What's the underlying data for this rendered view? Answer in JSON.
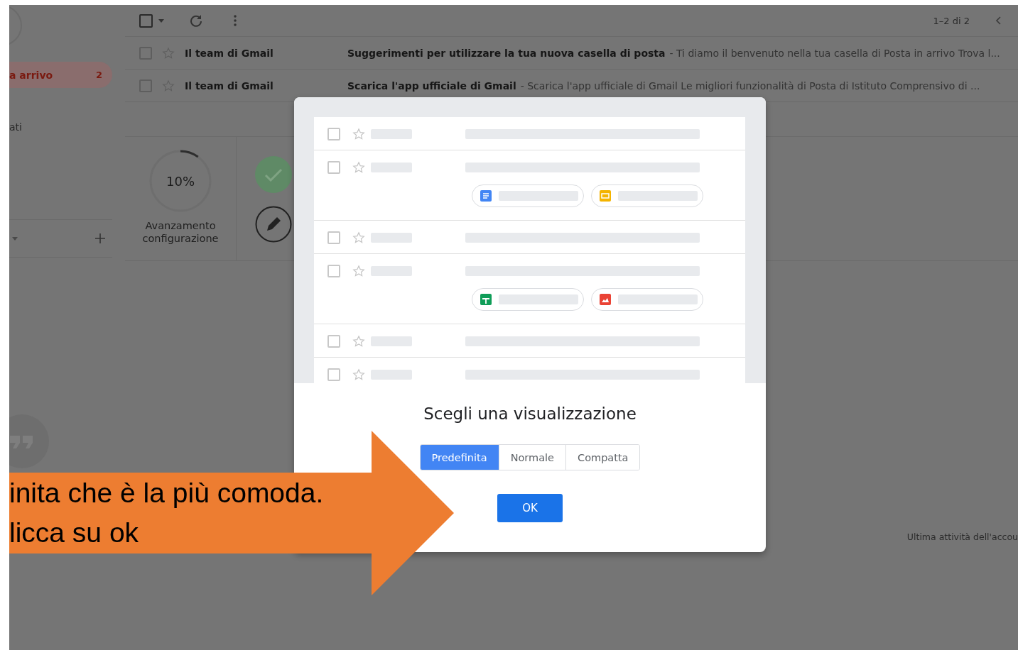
{
  "sidebar": {
    "items": [
      {
        "label": "a arrivo",
        "count": "2",
        "selected": true
      },
      {
        "label": "ati",
        "selected": false
      }
    ]
  },
  "toolbar": {
    "select_all_checked": false,
    "page_info": "1–2 di 2"
  },
  "emails": [
    {
      "checked": false,
      "sender": "Il team di Gmail",
      "subject": "Suggerimenti per utilizzare la tua nuova casella di posta",
      "snippet": "- Ti diamo il benvenuto nella tua casella di Posta in arrivo Trova l..."
    },
    {
      "checked": false,
      "sender": "Il team di Gmail",
      "subject": "Scarica l'app ufficiale di Gmail",
      "snippet": "- Scarica l'app ufficiale di Gmail Le migliori funzionalità di Posta di Istituto Comprensivo di ..."
    }
  ],
  "setup": {
    "progress": {
      "reading": "10%",
      "level": 0.1
    },
    "caption": "Avanzamento configurazione"
  },
  "footer": {
    "last_activity": "Ultima attività dell'accou"
  },
  "dialog": {
    "title": "Scegli una visualizzazione",
    "preview_rows": [
      {
        "checked": false,
        "attachments": []
      },
      {
        "checked": false,
        "attachments": [
          {
            "kind": "doc"
          },
          {
            "kind": "slides"
          }
        ]
      },
      {
        "checked": false,
        "attachments": []
      },
      {
        "checked": false,
        "attachments": [
          {
            "kind": "sheet"
          },
          {
            "kind": "image"
          }
        ]
      },
      {
        "checked": false,
        "attachments": []
      },
      {
        "checked": false,
        "attachments": []
      }
    ],
    "views": [
      {
        "label": "Predefinita",
        "selected": true
      },
      {
        "label": "Normale",
        "selected": false
      },
      {
        "label": "Compatta",
        "selected": false
      }
    ],
    "ok_button": "OK"
  },
  "callout": {
    "lines": [
      "inita che è la più comoda.",
      "licca su ok"
    ]
  }
}
